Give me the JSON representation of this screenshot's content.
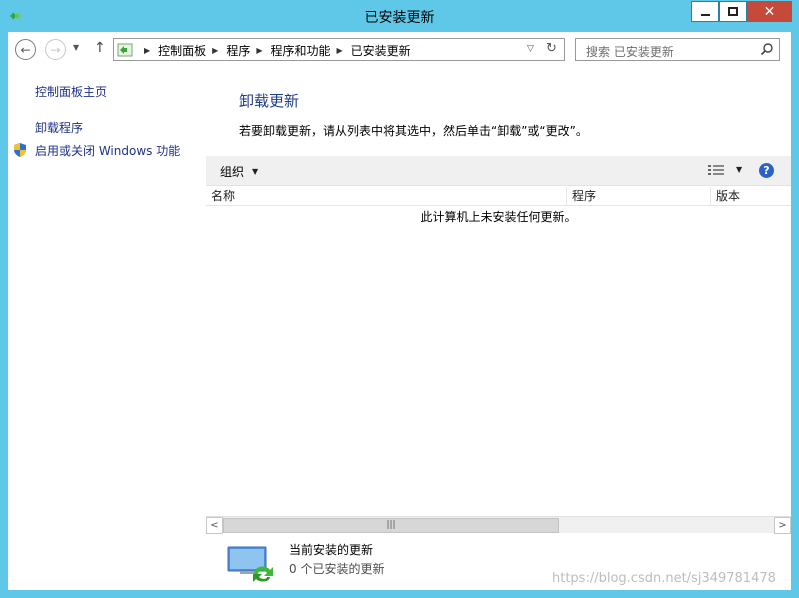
{
  "window": {
    "title": "已安装更新",
    "app_icon": "control-panel-icon",
    "controls": {
      "minimize": "minimize-icon",
      "maximize": "maximize-icon",
      "close_label": "✕"
    }
  },
  "nav": {
    "back": "back-arrow-icon",
    "forward": "forward-arrow-icon",
    "recent": "chevron-down-icon",
    "up": "up-arrow-icon"
  },
  "address": {
    "breadcrumbs": [
      "控制面板",
      "程序",
      "程序和功能",
      "已安装更新"
    ],
    "dropdown": "chevron-down-icon",
    "refresh": "refresh-icon"
  },
  "search": {
    "placeholder": "搜索 已安装更新"
  },
  "sidebar": {
    "items": [
      {
        "label": "控制面板主页"
      },
      {
        "label": "卸载程序"
      },
      {
        "label": "启用或关闭 Windows 功能",
        "icon": "shield-icon"
      }
    ]
  },
  "main": {
    "heading": "卸载更新",
    "description": "若要卸载更新，请从列表中将其选中，然后单击“卸载”或“更改”。"
  },
  "toolbar": {
    "organize_label": "组织",
    "view_icon": "view-list-icon",
    "help_label": "?"
  },
  "list": {
    "columns": [
      "名称",
      "程序",
      "版本"
    ],
    "empty_message": "此计算机上未安装任何更新。"
  },
  "details": {
    "title": "当前安装的更新",
    "count_text": "0 个已安装的更新"
  },
  "watermark": "https://blog.csdn.net/sj349781478",
  "colors": {
    "frame": "#5fc7e8",
    "close_button": "#c7493a",
    "link": "#1e3287",
    "heading": "#1e3e8a"
  }
}
